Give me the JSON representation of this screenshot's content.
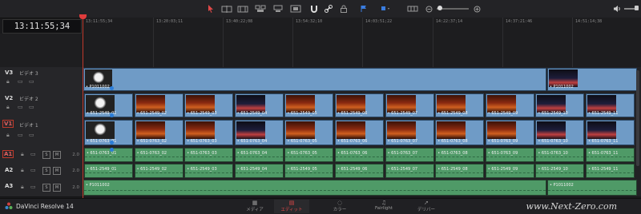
{
  "timecode": "13:11:55;34",
  "ruler_ticks": [
    "13:11:55;34",
    "13:20:03;11",
    "13:40:22;08",
    "13:54:32;10",
    "14:03:51;22",
    "14:22:37;14",
    "14:37:21:46",
    "14:51:14;38"
  ],
  "tracks": {
    "v3": {
      "name": "V3",
      "label": "ビデオ 3"
    },
    "v2": {
      "name": "V2",
      "label": "ビデオ 2"
    },
    "v1": {
      "name": "V1",
      "label": "ビデオ 1"
    },
    "a1": {
      "name": "A1",
      "db": "2.0"
    },
    "a2": {
      "name": "A2",
      "db": "2.0"
    },
    "a3": {
      "name": "A3",
      "db": "2.0"
    }
  },
  "v3_clips": [
    "P1011002",
    "P1011002"
  ],
  "v2_clips": [
    "651-2549_01",
    "651-2549_02",
    "651-2549_03",
    "651-2549_04",
    "651-2549_05",
    "651-2549_06",
    "651-2549_07",
    "651-2549_08",
    "651-2549_09",
    "651-2549_10",
    "651-2549_11"
  ],
  "v1_clips": [
    "651-0763_01",
    "651-0763_02",
    "651-0763_03",
    "651-0763_04",
    "651-0763_05",
    "651-0763_06",
    "651-0763_07",
    "651-0763_08",
    "651-0763_09",
    "651-0763_10",
    "651-0763_11"
  ],
  "a1_clips": [
    "651-0763_01",
    "651-0763_02",
    "651-0763_03",
    "651-0763_04",
    "651-0763_05",
    "651-0763_06",
    "651-0763_07",
    "651-0763_08",
    "651-0763_09",
    "651-0763_10",
    "651-0763_11"
  ],
  "a2_clips": [
    "651-2549_01",
    "651-2549_02",
    "651-2549_03",
    "651-2549_04",
    "651-2549_05",
    "651-2549_06",
    "651-2549_07",
    "651-2549_08",
    "651-2549_09",
    "651-2549_10",
    "651-2549_11"
  ],
  "a3_clips": [
    "P1011002",
    "P1011002"
  ],
  "app_name": "DaVinci Resolve 14",
  "pages": {
    "media": "メディア",
    "edit": "エディット",
    "color": "カラー",
    "fairlight": "Fairlight",
    "deliver": "デリバー"
  },
  "watermark": "www.Next-Zero.com",
  "colors": {
    "video_clip": "#6f9bc6",
    "audio_clip": "#4f9a67",
    "playhead": "#c0392b",
    "active_page": "#e04848"
  }
}
